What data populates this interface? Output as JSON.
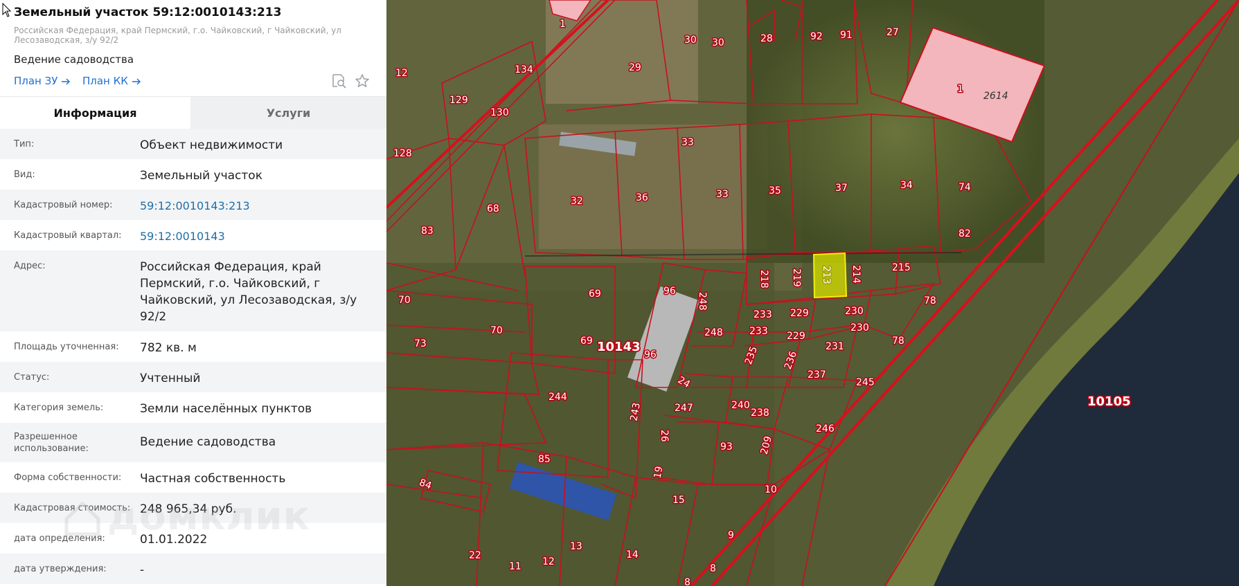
{
  "header": {
    "title": "Земельный участок 59:12:0010143:213",
    "address_sub": "Российская Федерация, край Пермский, г.о. Чайковский, г Чайковский, ул Лесозаводская, з/у 92/2",
    "use": "Ведение садоводства",
    "plan_zu": "План ЗУ",
    "plan_kk": "План КК",
    "icons": [
      "search-document-icon",
      "star-icon"
    ]
  },
  "tabs": [
    {
      "label": "Информация",
      "active": true
    },
    {
      "label": "Услуги",
      "active": false
    }
  ],
  "rows": [
    {
      "label": "Тип:",
      "value": "Объект недвижимости"
    },
    {
      "label": "Вид:",
      "value": "Земельный участок"
    },
    {
      "label": "Кадастровый номер:",
      "value": "59:12:0010143:213",
      "link": true
    },
    {
      "label": "Кадастровый квартал:",
      "value": "59:12:0010143",
      "link": true
    },
    {
      "label": "Адрес:",
      "value": "Российская Федерация, край Пермский, г.о. Чайковский, г Чайковский, ул Лесозаводская, з/у 92/2"
    },
    {
      "label": "Площадь уточненная:",
      "value": "782 кв. м"
    },
    {
      "label": "Статус:",
      "value": "Учтенный"
    },
    {
      "label": "Категория земель:",
      "value": "Земли населённых пунктов"
    },
    {
      "label": "Разрешенное использование:",
      "value": "Ведение садоводства"
    },
    {
      "label": "Форма собственности:",
      "value": "Частная собственность"
    },
    {
      "label": "Кадастровая стоимость:",
      "value": "248 965,34 руб."
    },
    {
      "label": "дата определения:",
      "value": "01.01.2022"
    },
    {
      "label": "дата утверждения:",
      "value": "-"
    }
  ],
  "watermark": "домклик",
  "map": {
    "quarter_labels": [
      "10143",
      "10105"
    ],
    "selected_parcel": "213",
    "parcel_labels": [
      "1",
      "30",
      "30",
      "28",
      "92",
      "91",
      "27",
      "29",
      "12",
      "134",
      "129",
      "130",
      "128",
      "1",
      "2614",
      "33",
      "32",
      "36",
      "33",
      "35",
      "37",
      "34",
      "74",
      "68",
      "82",
      "83",
      "218",
      "219",
      "213",
      "214",
      "215",
      "69",
      "96",
      "248",
      "233",
      "229",
      "230",
      "78",
      "70",
      "70",
      "233",
      "229",
      "230",
      "73",
      "69",
      "10143",
      "248",
      "231",
      "78",
      "96",
      "235",
      "236",
      "237",
      "245",
      "24",
      "244",
      "243",
      "247",
      "240",
      "238",
      "246",
      "26",
      "93",
      "209",
      "85",
      "19",
      "84",
      "15",
      "10",
      "22",
      "9",
      "13",
      "14",
      "12",
      "11",
      "8",
      "8",
      "10105"
    ],
    "colors": {
      "boundary": "#c8101e",
      "selected_fill": "#d8e000",
      "building_fill": "#f2b6bc",
      "river": "#1f2a3a",
      "vegetation": "#4f5a2c"
    }
  }
}
